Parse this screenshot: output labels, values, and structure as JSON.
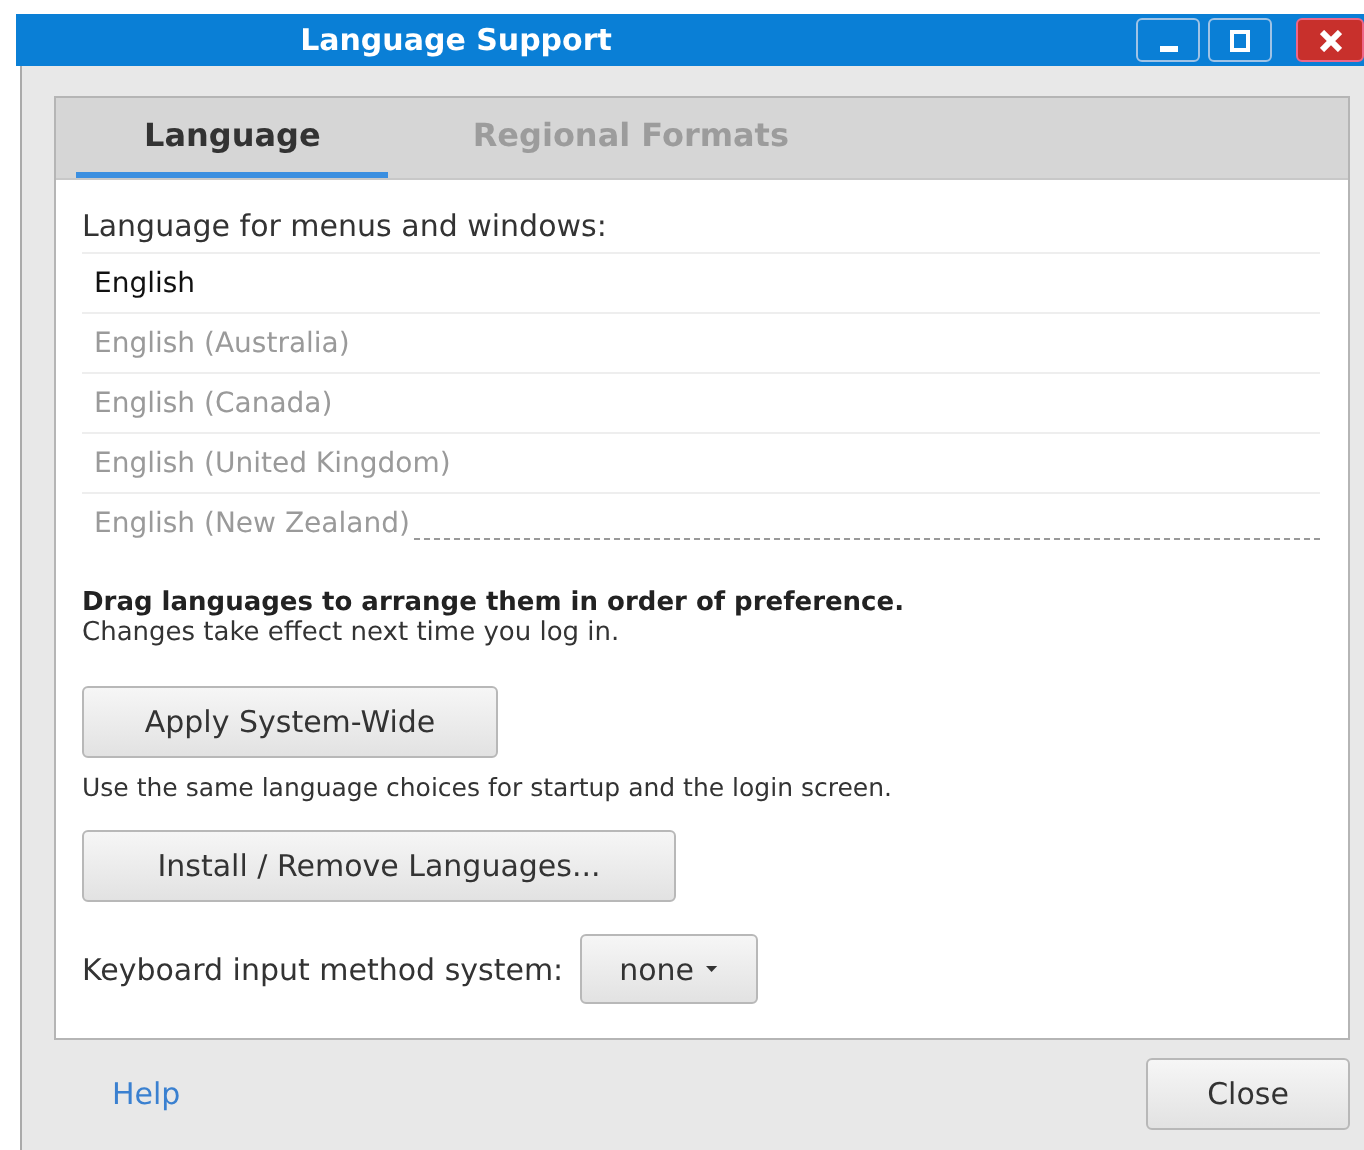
{
  "window": {
    "title": "Language Support"
  },
  "tabs": [
    {
      "label": "Language",
      "selected": true
    },
    {
      "label": "Regional Formats",
      "selected": false
    }
  ],
  "language_section": {
    "heading": "Language for menus and windows:",
    "languages": [
      {
        "label": "English",
        "disabled": false,
        "drop_marker": false
      },
      {
        "label": "English (Australia)",
        "disabled": true,
        "drop_marker": false
      },
      {
        "label": "English (Canada)",
        "disabled": true,
        "drop_marker": false
      },
      {
        "label": "English (United Kingdom)",
        "disabled": true,
        "drop_marker": false
      },
      {
        "label": "English (New Zealand)",
        "disabled": true,
        "drop_marker": true
      }
    ],
    "hint": "Drag languages to arrange them in order of preference.",
    "note": "Changes take effect next time you log in."
  },
  "apply_button": "Apply System-Wide",
  "apply_note": "Use the same language choices for startup and the login screen.",
  "install_button": "Install / Remove Languages...",
  "input_method": {
    "label": "Keyboard input method system:",
    "value": "none"
  },
  "help_link": "Help",
  "close_button": "Close"
}
